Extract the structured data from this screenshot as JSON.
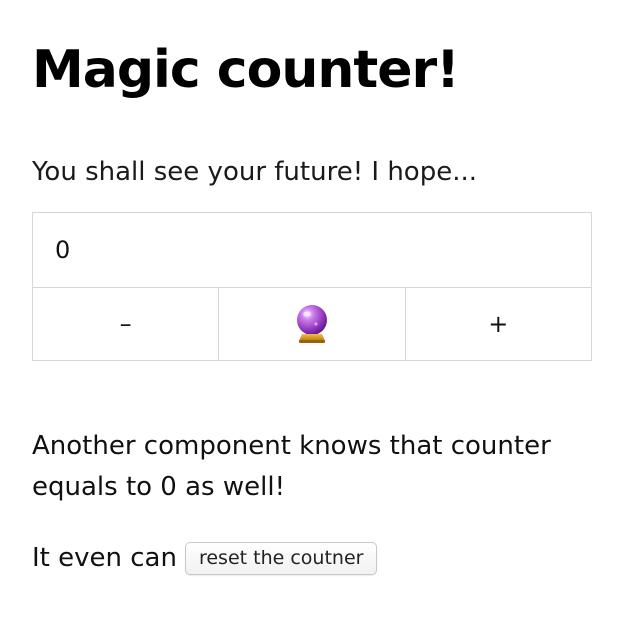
{
  "header": {
    "title": "Magic counter!"
  },
  "subtitle": "You shall see your future! I hope...",
  "counter": {
    "value": "0",
    "decrement_label": "–",
    "magic_icon": "crystal-ball-icon",
    "increment_label": "+"
  },
  "note": "Another component knows that counter equals to 0 as well!",
  "reset": {
    "prefix": "It even can",
    "button_label": "reset the coutner"
  },
  "colors": {
    "border": "#d6d6d6",
    "ball_purple": "#9b3fc9",
    "ball_stand": "#d89a1e"
  }
}
